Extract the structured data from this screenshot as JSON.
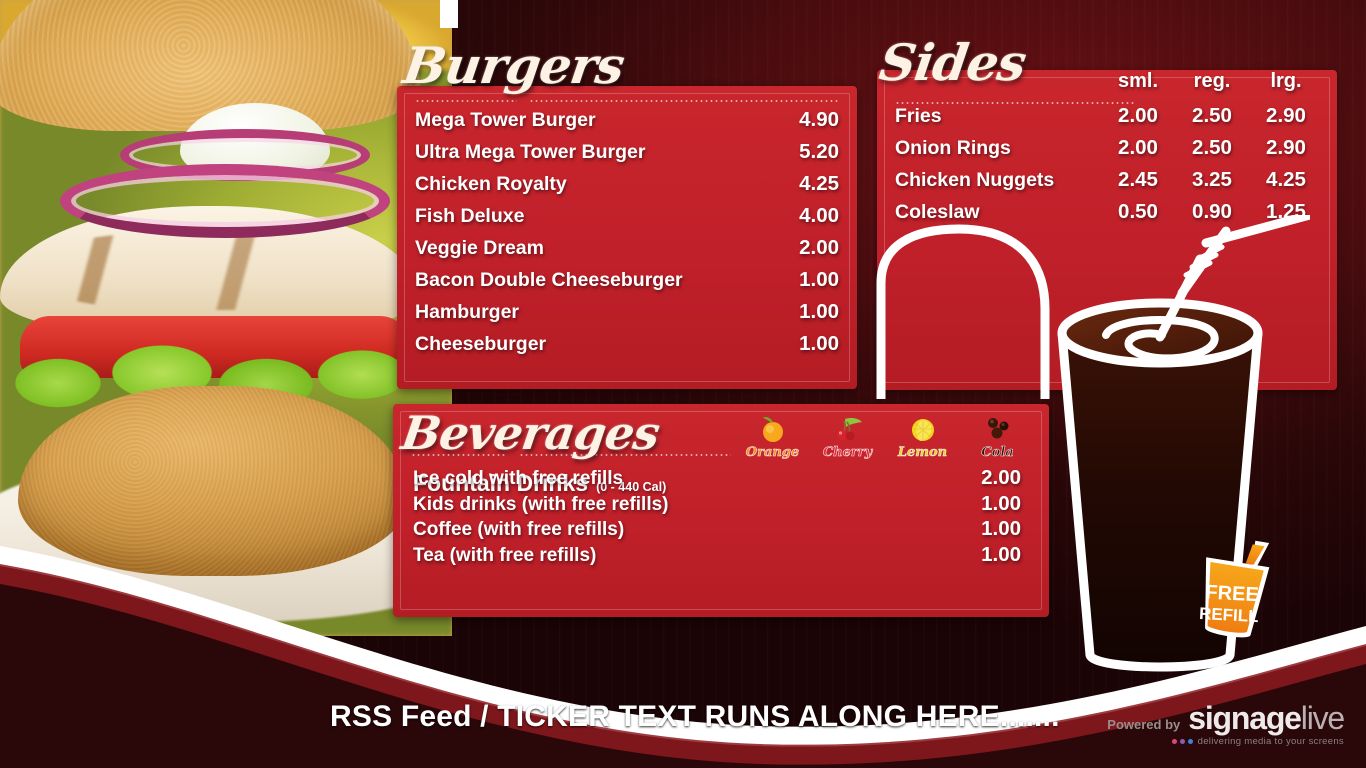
{
  "board": {
    "accent_red": "#c0202a",
    "background_dark": "#2a0708",
    "text_cream": "#fdf2e4"
  },
  "burgers": {
    "title": "Burgers",
    "items": [
      {
        "name": "Mega Tower Burger",
        "price": "4.90"
      },
      {
        "name": "Ultra Mega Tower Burger",
        "price": "5.20"
      },
      {
        "name": "Chicken Royalty",
        "price": "4.25"
      },
      {
        "name": "Fish Deluxe",
        "price": "4.00"
      },
      {
        "name": "Veggie Dream",
        "price": "2.00"
      },
      {
        "name": "Bacon Double Cheeseburger",
        "price": "1.00"
      },
      {
        "name": "Hamburger",
        "price": "1.00"
      },
      {
        "name": "Cheeseburger",
        "price": "1.00"
      }
    ]
  },
  "sides": {
    "title": "Sides",
    "columns": [
      "sml.",
      "reg.",
      "lrg."
    ],
    "items": [
      {
        "name": "Fries",
        "sml": "2.00",
        "reg": "2.50",
        "lrg": "2.90"
      },
      {
        "name": "Onion Rings",
        "sml": "2.00",
        "reg": "2.50",
        "lrg": "2.90"
      },
      {
        "name": "Chicken Nuggets",
        "sml": "2.45",
        "reg": "3.25",
        "lrg": "4.25"
      },
      {
        "name": "Coleslaw",
        "sml": "0.50",
        "reg": "0.90",
        "lrg": "1.25"
      }
    ]
  },
  "beverages": {
    "title": "Beverages",
    "subtitle": "Fountain Drinks",
    "calories": "(0 - 440 Cal)",
    "flavours": [
      {
        "label": "Orange",
        "icon": "orange-fruit-icon"
      },
      {
        "label": "Cherry",
        "icon": "cherry-fruit-icon"
      },
      {
        "label": "Lemon",
        "icon": "lemon-fruit-icon"
      },
      {
        "label": "Cola",
        "icon": "cola-bean-icon"
      }
    ],
    "items": [
      {
        "name": "Ice cold with free refills",
        "price": "2.00"
      },
      {
        "name": "Kids drinks (with free refills)",
        "price": "1.00"
      },
      {
        "name": "Coffee (with free refills)",
        "price": "1.00"
      },
      {
        "name": "Tea (with free refills)",
        "price": "1.00"
      }
    ]
  },
  "promo": {
    "badge_line1": "FREE",
    "badge_line2": "REFILL"
  },
  "ticker": {
    "text": "RSS Feed / TICKER TEXT RUNS ALONG HERE......."
  },
  "branding": {
    "powered_by": "Powered by",
    "name_first": "signage",
    "name_second": "live",
    "tagline": "delivering media to your screens",
    "dot_colors": [
      "#e0457f",
      "#8e5bb5",
      "#3d86d6"
    ]
  }
}
